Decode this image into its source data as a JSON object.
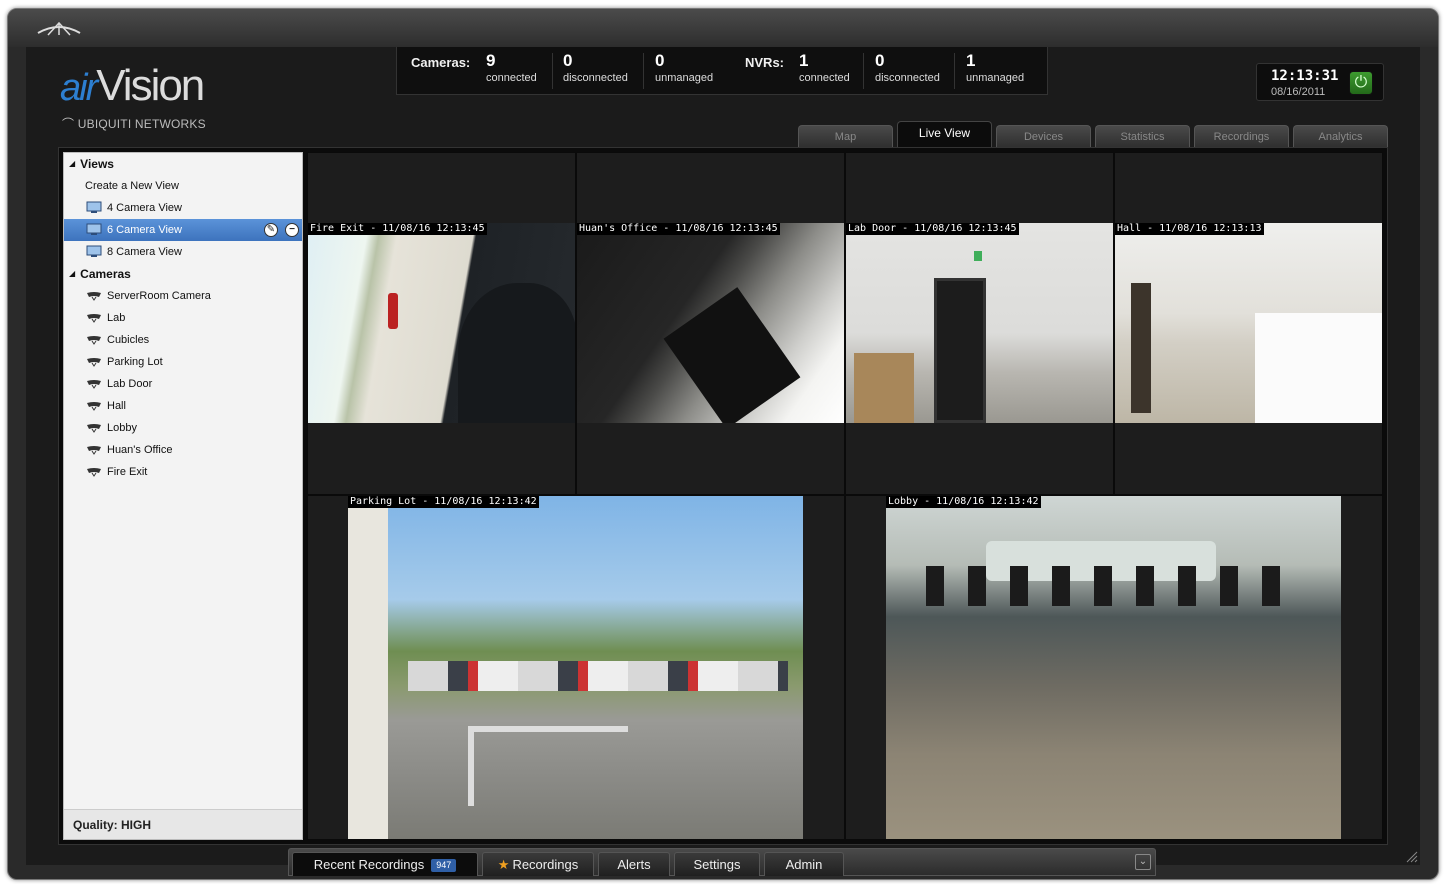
{
  "stats": {
    "cameras_label": "Cameras:",
    "cameras": [
      {
        "num": "9",
        "label": "connected"
      },
      {
        "num": "0",
        "label": "disconnected"
      },
      {
        "num": "0",
        "label": "unmanaged"
      }
    ],
    "nvrs_label": "NVRs:",
    "nvrs": [
      {
        "num": "1",
        "label": "connected"
      },
      {
        "num": "0",
        "label": "disconnected"
      },
      {
        "num": "1",
        "label": "unmanaged"
      }
    ]
  },
  "logo": {
    "air": "air",
    "vision": "Vision",
    "sub": "UBIQUITI NETWORKS"
  },
  "clock": {
    "time": "12:13:31",
    "date": "08/16/2011",
    "power_icon": "power-icon"
  },
  "tabs": [
    {
      "label": "Map",
      "active": false
    },
    {
      "label": "Live View",
      "active": true
    },
    {
      "label": "Devices",
      "active": false
    },
    {
      "label": "Statistics",
      "active": false
    },
    {
      "label": "Recordings",
      "active": false
    },
    {
      "label": "Analytics",
      "active": false
    }
  ],
  "sidebar": {
    "views_header": "Views",
    "views": [
      {
        "label": "Create a New View"
      },
      {
        "label": "4 Camera View"
      },
      {
        "label": "6 Camera View",
        "selected": true
      },
      {
        "label": "8 Camera View"
      }
    ],
    "cameras_header": "Cameras",
    "cameras": [
      "ServerRoom Camera",
      "Lab",
      "Cubicles",
      "Parking Lot",
      "Lab Door",
      "Hall",
      "Lobby",
      "Huan's Office",
      "Fire Exit"
    ],
    "quality": "Quality: HIGH"
  },
  "feeds": [
    "Fire Exit - 11/08/16 12:13:45",
    "Huan's Office - 11/08/16 12:13:45",
    "Lab Door - 11/08/16 12:13:45",
    "Hall - 11/08/16 12:13:13",
    "Parking Lot - 11/08/16 12:13:42",
    "Lobby - 11/08/16 12:13:42"
  ],
  "bottom": {
    "recent": "Recent Recordings",
    "recent_count": "947",
    "recordings": "Recordings",
    "alerts": "Alerts",
    "settings": "Settings",
    "admin": "Admin"
  }
}
